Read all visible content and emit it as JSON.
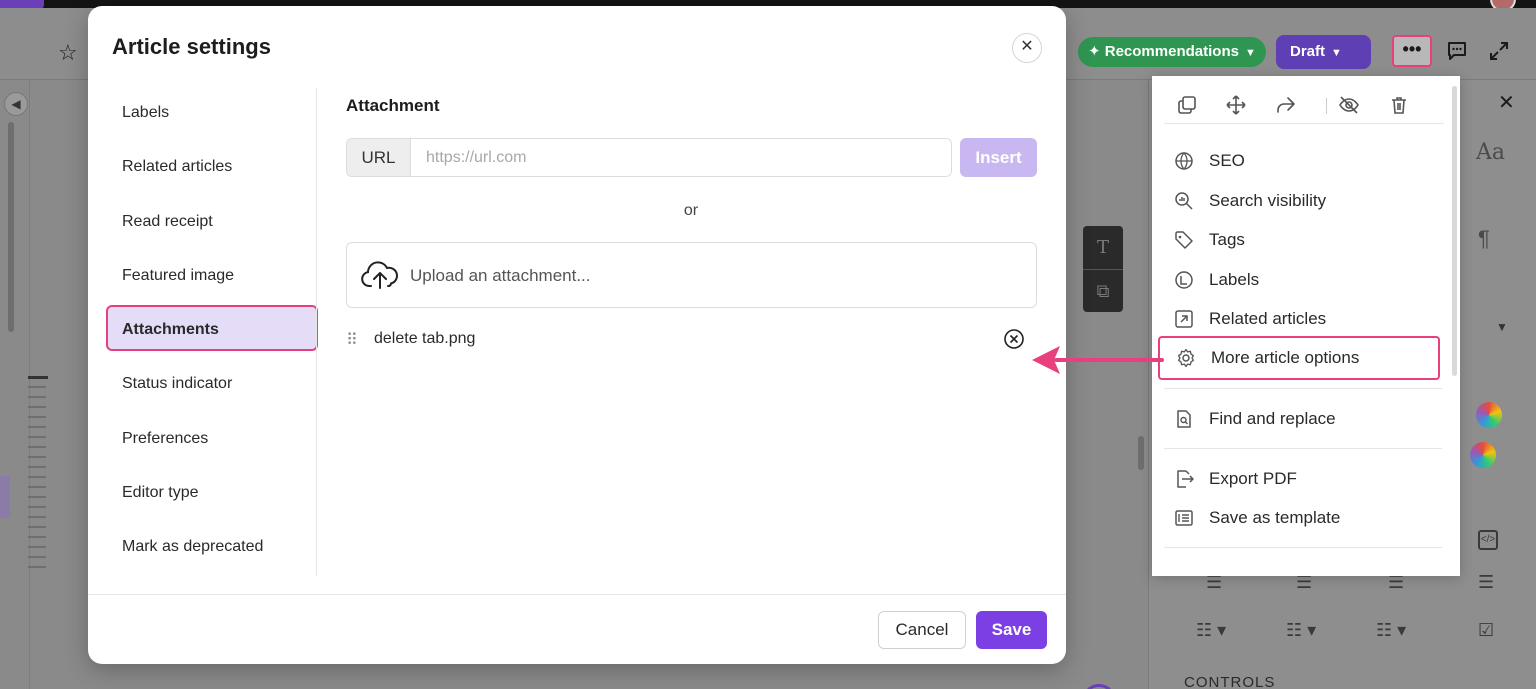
{
  "modal": {
    "title": "Article settings",
    "nav": [
      {
        "label": "Labels",
        "active": false
      },
      {
        "label": "Related articles",
        "active": false
      },
      {
        "label": "Read receipt",
        "active": false
      },
      {
        "label": "Featured image",
        "active": false
      },
      {
        "label": "Attachments",
        "active": true
      },
      {
        "label": "Status indicator",
        "active": false
      },
      {
        "label": "Preferences",
        "active": false
      },
      {
        "label": "Editor type",
        "active": false
      },
      {
        "label": "Mark as deprecated",
        "active": false
      }
    ],
    "attachment": {
      "title": "Attachment",
      "url_prefix": "URL",
      "url_placeholder": "https://url.com",
      "url_value": "",
      "insert_label": "Insert",
      "or_label": "or",
      "upload_label": "Upload an attachment...",
      "files": [
        {
          "name": "delete tab.png"
        }
      ]
    },
    "footer": {
      "cancel_label": "Cancel",
      "save_label": "Save"
    }
  },
  "header": {
    "recommendations_label": "Recommendations",
    "status_label": "Draft"
  },
  "menu": {
    "icon_actions": [
      "copy-icon",
      "move-icon",
      "share-icon",
      "hide-icon",
      "trash-icon"
    ],
    "items": [
      {
        "label": "SEO",
        "icon": "seo-icon"
      },
      {
        "label": "Search visibility",
        "icon": "search-visibility-icon"
      },
      {
        "label": "Tags",
        "icon": "tag-icon"
      },
      {
        "label": "Labels",
        "icon": "label-icon"
      },
      {
        "label": "Related articles",
        "icon": "related-articles-icon"
      },
      {
        "label": "More article options",
        "icon": "gear-icon"
      },
      {
        "label": "Find and replace",
        "icon": "find-replace-icon"
      },
      {
        "label": "Export PDF",
        "icon": "export-pdf-icon"
      },
      {
        "label": "Save as template",
        "icon": "template-icon"
      }
    ]
  },
  "right_panel": {
    "controls_label": "CONTROLS"
  },
  "colors": {
    "accent_purple": "#7b3fe4",
    "insert_disabled": "#c9b7f2",
    "active_nav_bg": "#e5ddf7",
    "highlight_pink": "#e8407e",
    "recommendations_green": "#2e9650"
  }
}
